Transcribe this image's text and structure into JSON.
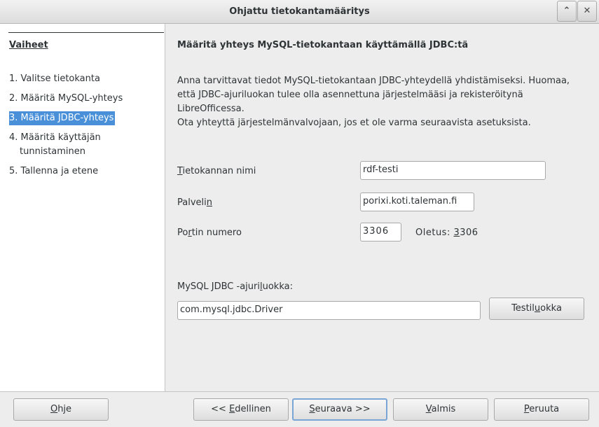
{
  "window": {
    "title": "Ohjattu tietokantamääritys",
    "minimize_glyph": "⌃",
    "close_glyph": "✕"
  },
  "steps": {
    "heading": "Vaiheet",
    "items": [
      {
        "num": "1.",
        "label": "Valitse tietokanta"
      },
      {
        "num": "2.",
        "label": "Määritä MySQL-yhteys"
      },
      {
        "num": "3.",
        "label": "Määritä JDBC-yhteys"
      },
      {
        "num": "4.",
        "label": "Määritä käyttäjän",
        "label2": "tunnistaminen"
      },
      {
        "num": "5.",
        "label": "Tallenna ja etene"
      }
    ],
    "selected": 2
  },
  "main": {
    "title": "Määritä yhteys MySQL-tietokantaan käyttämällä JDBC:tä",
    "description": [
      "Anna tarvittavat tiedot MySQL-tietokantaan JDBC-yhteydellä yhdistämiseksi. Huomaa,",
      "että JDBC-ajuriluokan tulee olla asennettuna järjestelmääsi ja rekisteröitynä",
      "LibreOfficessa.",
      "Ota yhteyttä järjestelmänvalvojaan, jos et ole varma seuraavista asetuksista."
    ],
    "db_name": {
      "label_pre": "",
      "label_u": "T",
      "label_post": "ietokannan nimi",
      "value": "rdf-testi"
    },
    "server": {
      "label_pre": "Palveli",
      "label_u": "n",
      "label_post": "",
      "value": "porixi.koti.taleman.fi"
    },
    "port": {
      "label_pre": "Po",
      "label_u": "r",
      "label_post": "tin numero",
      "value": "3306",
      "default_pre": "Oletus: ",
      "default_u": "3",
      "default_post": "306"
    },
    "driver": {
      "label_pre": "MySQL JDBC -ajuri",
      "label_u": "l",
      "label_post": "uokka:",
      "value": "com.mysql.jdbc.Driver"
    },
    "test_button": {
      "pre": "Testil",
      "u": "u",
      "post": "okka"
    }
  },
  "footer": {
    "help": {
      "pre": "",
      "u": "O",
      "post": "hje"
    },
    "back": {
      "pre": "<< ",
      "u": "E",
      "post": "dellinen"
    },
    "next": {
      "pre": "",
      "u": "S",
      "post": "euraava >>"
    },
    "finish": {
      "pre": "",
      "u": "V",
      "post": "almis"
    },
    "cancel": {
      "pre": "",
      "u": "P",
      "post": "eruuta"
    }
  }
}
